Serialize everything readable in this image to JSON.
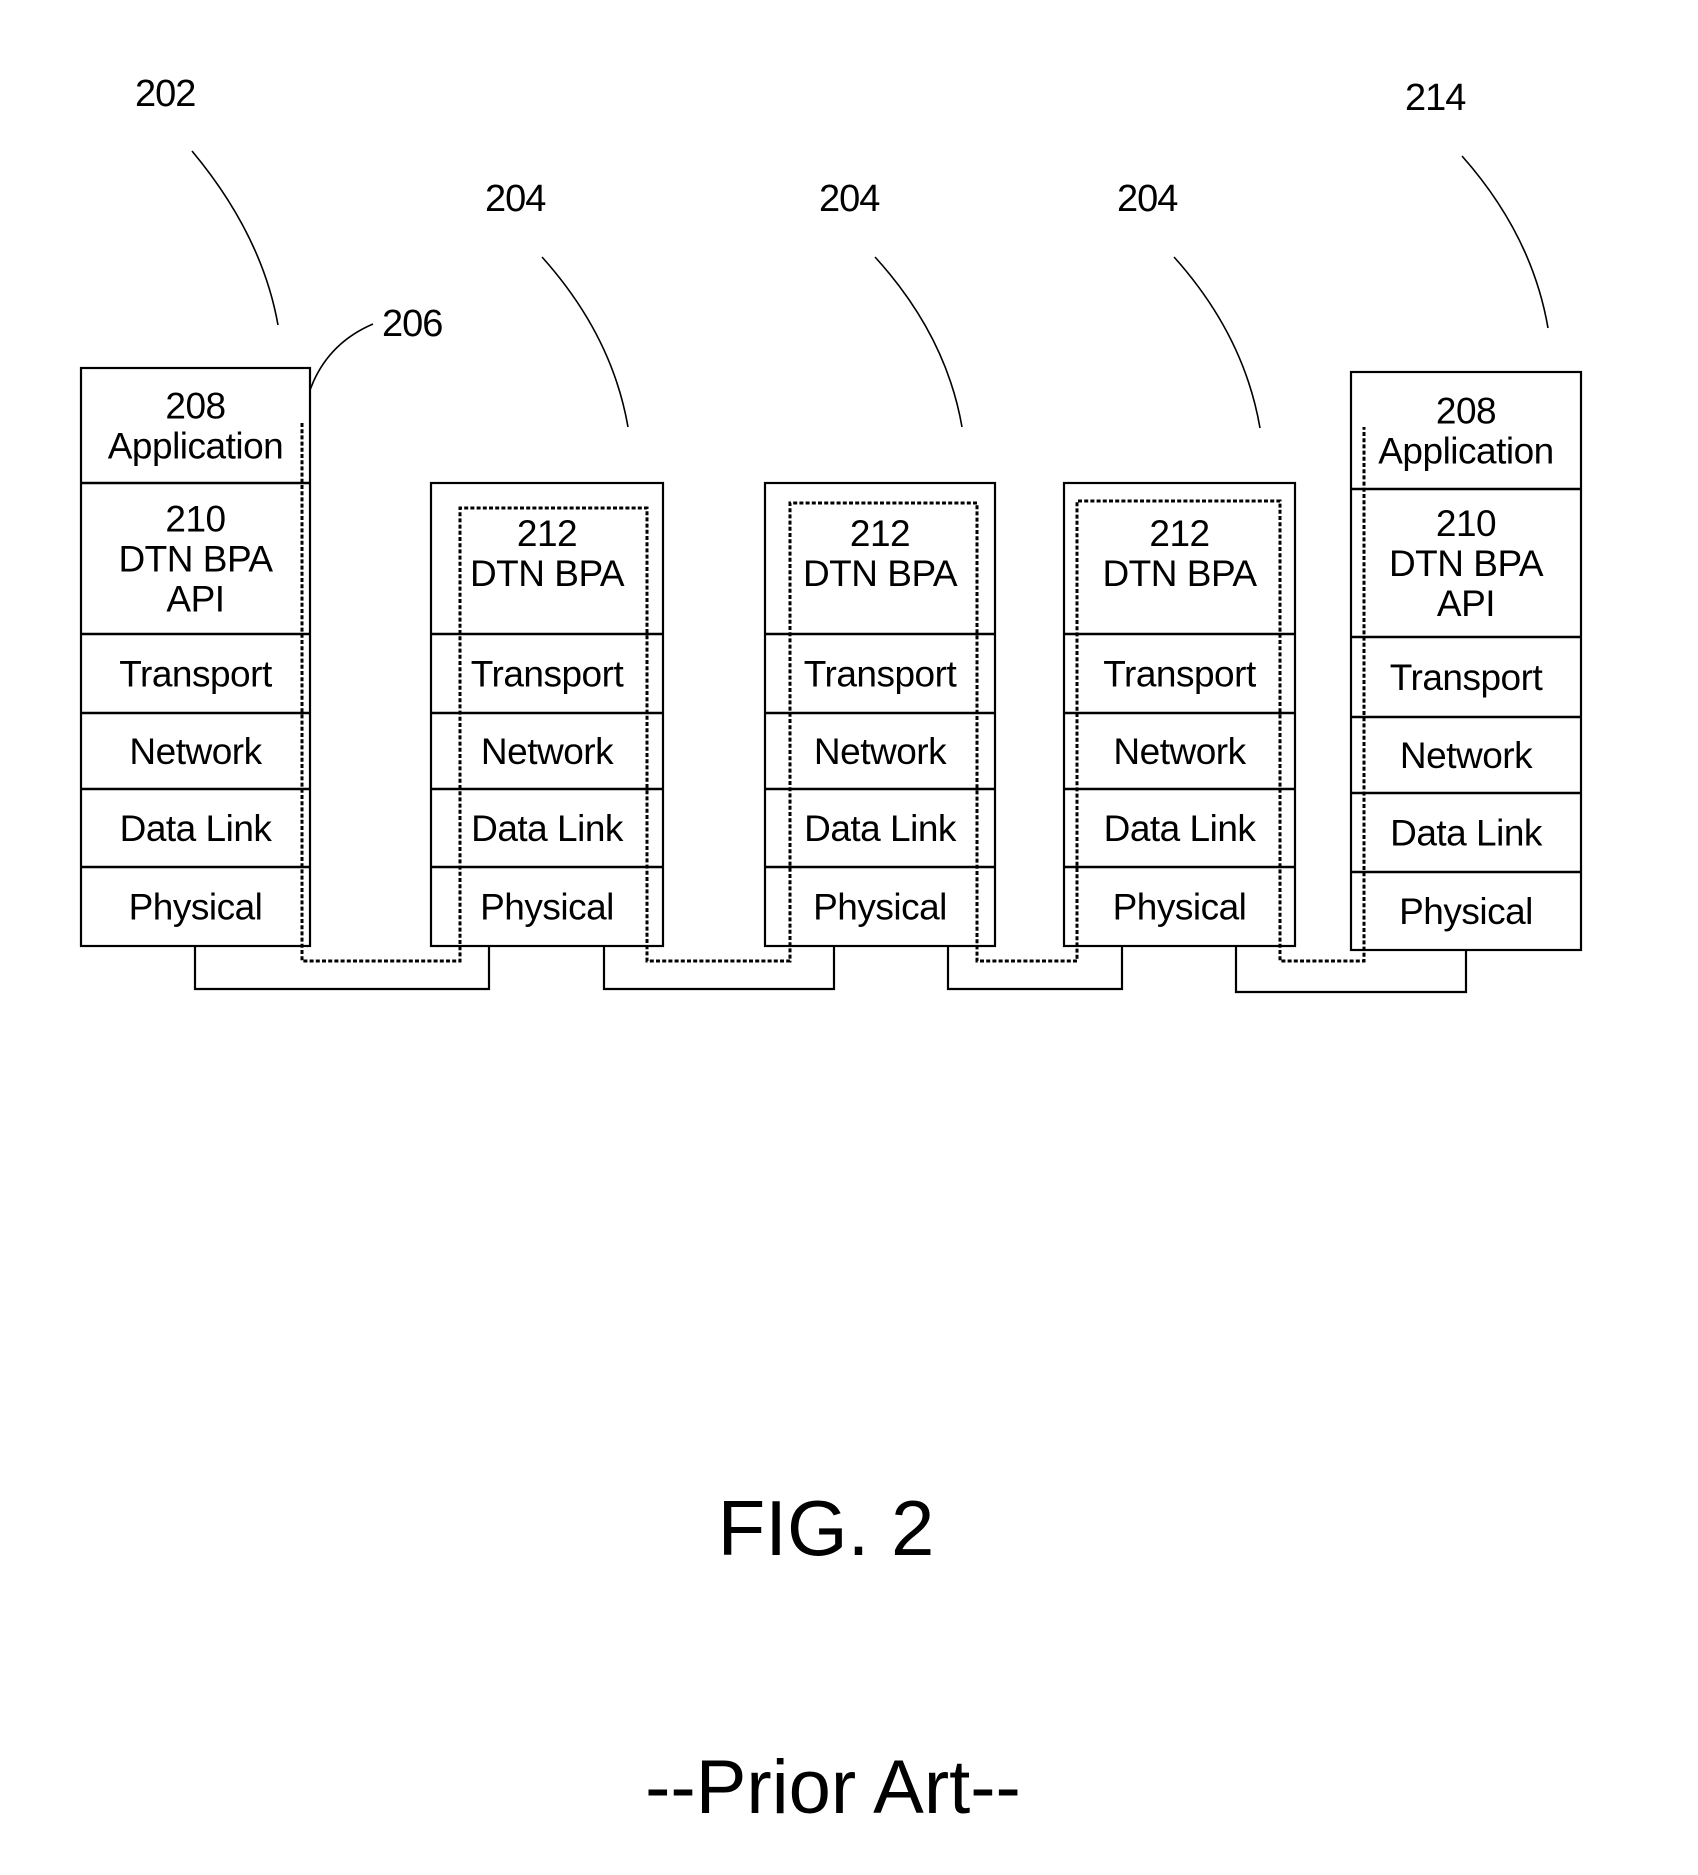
{
  "figure": {
    "title": "FIG. 2",
    "subtitle": "--Prior Art--"
  },
  "reference_labels": {
    "source_node": "202",
    "intermediate_node_1": "204",
    "intermediate_node_2": "204",
    "intermediate_node_3": "204",
    "data_path": "206",
    "destination_node": "214"
  },
  "stacks": [
    {
      "id": "source-node",
      "ref": "202",
      "layers": [
        {
          "lines": [
            "208",
            "Application"
          ]
        },
        {
          "lines": [
            "210",
            "DTN BPA",
            "API"
          ]
        },
        {
          "lines": [
            "Transport"
          ]
        },
        {
          "lines": [
            "Network"
          ]
        },
        {
          "lines": [
            "Data Link"
          ]
        },
        {
          "lines": [
            "Physical"
          ]
        }
      ]
    },
    {
      "id": "intermediate-node-1",
      "ref": "204",
      "layers": [
        {
          "lines": [
            "212",
            "DTN BPA"
          ]
        },
        {
          "lines": [
            "Transport"
          ]
        },
        {
          "lines": [
            "Network"
          ]
        },
        {
          "lines": [
            "Data Link"
          ]
        },
        {
          "lines": [
            "Physical"
          ]
        }
      ]
    },
    {
      "id": "intermediate-node-2",
      "ref": "204",
      "layers": [
        {
          "lines": [
            "212",
            "DTN BPA"
          ]
        },
        {
          "lines": [
            "Transport"
          ]
        },
        {
          "lines": [
            "Network"
          ]
        },
        {
          "lines": [
            "Data Link"
          ]
        },
        {
          "lines": [
            "Physical"
          ]
        }
      ]
    },
    {
      "id": "intermediate-node-3",
      "ref": "204",
      "layers": [
        {
          "lines": [
            "212",
            "DTN BPA"
          ]
        },
        {
          "lines": [
            "Transport"
          ]
        },
        {
          "lines": [
            "Network"
          ]
        },
        {
          "lines": [
            "Data Link"
          ]
        },
        {
          "lines": [
            "Physical"
          ]
        }
      ]
    },
    {
      "id": "destination-node",
      "ref": "214",
      "layers": [
        {
          "lines": [
            "208",
            "Application"
          ]
        },
        {
          "lines": [
            "210",
            "DTN BPA",
            "API"
          ]
        },
        {
          "lines": [
            "Transport"
          ]
        },
        {
          "lines": [
            "Network"
          ]
        },
        {
          "lines": [
            "Data Link"
          ]
        },
        {
          "lines": [
            "Physical"
          ]
        }
      ]
    }
  ],
  "colors": {
    "ink": "#000000",
    "paper": "#ffffff"
  }
}
